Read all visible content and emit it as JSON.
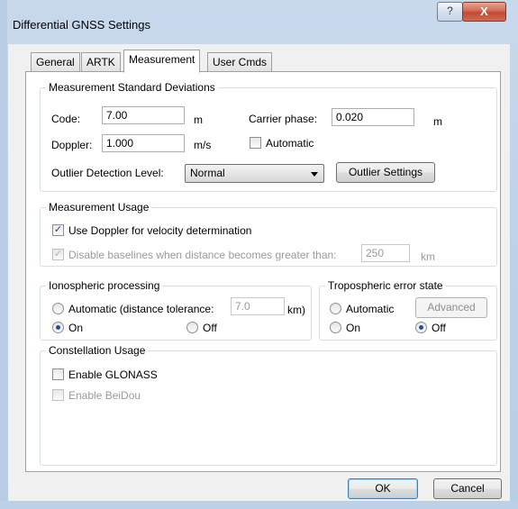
{
  "window": {
    "title": "Differential GNSS Settings",
    "help_glyph": "?",
    "close_glyph": "X"
  },
  "tabs": [
    {
      "label": "General"
    },
    {
      "label": "ARTK"
    },
    {
      "label": "Measurement"
    },
    {
      "label": "User Cmds"
    }
  ],
  "std_dev": {
    "group_label": "Measurement Standard Deviations",
    "code_label": "Code:",
    "code_value": "7.00",
    "code_unit": "m",
    "carrier_label": "Carrier phase:",
    "carrier_value": "0.020",
    "carrier_unit": "m",
    "doppler_label": "Doppler:",
    "doppler_value": "1.000",
    "doppler_unit": "m/s",
    "automatic_label": "Automatic",
    "automatic_checked": false,
    "outlier_label": "Outlier Detection Level:",
    "outlier_value": "Normal",
    "outlier_settings_label": "Outlier Settings"
  },
  "usage": {
    "group_label": "Measurement Usage",
    "use_doppler_label": "Use Doppler for velocity determination",
    "use_doppler_checked": true,
    "disable_baselines_label": "Disable baselines when distance becomes greater than:",
    "disable_baselines_checked": true,
    "distance_value": "250",
    "distance_unit": "km"
  },
  "iono": {
    "group_label": "Ionospheric processing",
    "automatic_label": "Automatic (distance tolerance:",
    "tolerance_value": "7.0",
    "tolerance_unit": "km)",
    "on_label": "On",
    "off_label": "Off",
    "selected": "On"
  },
  "tropo": {
    "group_label": "Tropospheric error state",
    "automatic_label": "Automatic",
    "advanced_label": "Advanced",
    "on_label": "On",
    "off_label": "Off",
    "selected": "Off"
  },
  "constellation": {
    "group_label": "Constellation Usage",
    "glonass_label": "Enable GLONASS",
    "glonass_checked": false,
    "beidou_label": "Enable BeiDou",
    "beidou_checked": false
  },
  "buttons": {
    "ok": "OK",
    "cancel": "Cancel"
  }
}
